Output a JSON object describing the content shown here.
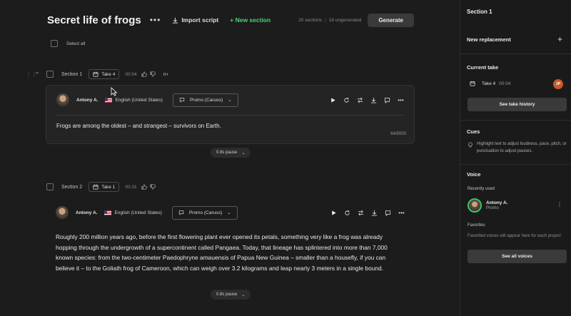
{
  "header": {
    "title": "Secret life of frogs",
    "import_label": "Import script",
    "new_section_label": "+ New section",
    "sections_count": "20 sections",
    "ungenerated_count": "18 ungenerated",
    "generate_label": "Generate"
  },
  "select_all_label": "Select all",
  "sections": [
    {
      "name": "Section 1",
      "take": "Take 4",
      "time": "00:04",
      "voice": "Antony A.",
      "language": "English (United States)",
      "style": "Promo (Caruso)",
      "text": "Frogs are among the oldest – and strangest – survivors on Earth.",
      "char_count": "64/5000",
      "pause": "0.8s pause"
    },
    {
      "name": "Section 2",
      "take": "Take 1",
      "time": "00:31",
      "voice": "Antony A.",
      "language": "English (United States)",
      "style": "Promo (Caruso)",
      "text": "Roughly 200 million years ago, before the first flowering plant ever opened its petals, something very like a frog was already hopping through the undergrowth of a supercontinent called Pangaea. Today, that lineage has splintered into more than 7,000 known species: from the two-centimeter Paedophryne amauensis of Papua New Guinea – smaller than a housefly, if you can believe it – to the Goliath frog of Cameroon, which can weigh over 3.2 kilograms and leap nearly 3 meters in a single bound.",
      "pause": "0.8s pause"
    }
  ],
  "sidebar": {
    "title": "Section 1",
    "new_replacement": "New replacement",
    "current_take_heading": "Current take",
    "current_take": "Take 4",
    "current_take_time": "00:04",
    "user_initials": "JP",
    "take_history_label": "See take history",
    "cues_heading": "Cues",
    "cues_text": "Highlight text to adjust loudness, pace, pitch, or punctuation to adjust pauses.",
    "voice_heading": "Voice",
    "recently_used_label": "Recently used",
    "recent_voice_name": "Antony A.",
    "recent_voice_style": "Promo",
    "favorites_label": "Favorites",
    "favorites_text": "Favorited voices will appear here for each project",
    "all_voices_label": "See all voices"
  },
  "colors": {
    "accent_green": "#4fd27a",
    "avatar_ring": "#3bc16c",
    "user_badge": "#c45a2a"
  }
}
